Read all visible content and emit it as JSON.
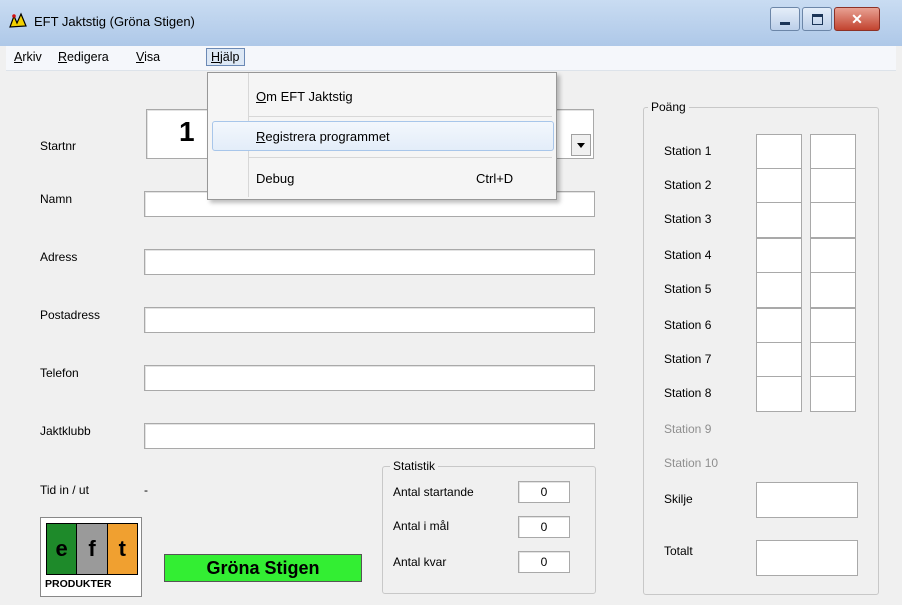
{
  "window": {
    "title": "EFT Jaktstig (Gröna Stigen)",
    "controls": [
      "minimize-icon",
      "maximize-icon",
      "close-icon"
    ]
  },
  "menubar": {
    "items": [
      {
        "accel": "A",
        "rest": "rkiv"
      },
      {
        "accel": "R",
        "rest": "edigera"
      },
      {
        "accel": "V",
        "rest": "isa"
      },
      {
        "accel": "H",
        "rest": "jälp"
      }
    ]
  },
  "help_menu": {
    "about": {
      "accel": "O",
      "rest": "m EFT Jaktstig"
    },
    "register": {
      "accel": "R",
      "rest": "egistrera programmet"
    },
    "debug": "Debug",
    "debug_shortcut": "Ctrl+D"
  },
  "form": {
    "startnr_label": "Startnr",
    "startnr_value": "1",
    "namn_label": "Namn",
    "adress_label": "Adress",
    "postadress_label": "Postadress",
    "telefon_label": "Telefon",
    "jaktklubb_label": "Jaktklubb",
    "tid_label": "Tid in / ut",
    "tid_value": "-"
  },
  "statistik": {
    "title": "Statistik",
    "startande_label": "Antal startande",
    "startande_value": "0",
    "i_mal_label": "Antal i mål",
    "i_mal_value": "0",
    "kvar_label": "Antal kvar",
    "kvar_value": "0"
  },
  "poang": {
    "title": "Poäng",
    "stations": [
      "Station 1",
      "Station 2",
      "Station 3",
      "Station 4",
      "Station 5",
      "Station 6",
      "Station 7",
      "Station 8",
      "Station 9",
      "Station 10"
    ],
    "skilje_label": "Skilje",
    "totalt_label": "Totalt"
  },
  "logo": {
    "letters": [
      "e",
      "f",
      "t"
    ],
    "subtitle": "PRODUKTER",
    "colors": [
      "#1e8a2a",
      "#9a9a9a",
      "#f0a030"
    ]
  },
  "banner": {
    "text": "Gröna Stigen",
    "color": "#33ee33"
  }
}
